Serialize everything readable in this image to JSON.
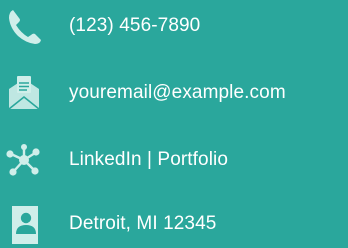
{
  "colors": {
    "background": "#2aa79c",
    "icon": "#cfeeea",
    "text": "#ffffff"
  },
  "contact": {
    "phone": {
      "icon": "phone-icon",
      "text": "(123) 456-7890"
    },
    "email": {
      "icon": "envelope-icon",
      "text": "youremail@example.com"
    },
    "links": {
      "icon": "network-icon",
      "text": "LinkedIn | Portfolio"
    },
    "location": {
      "icon": "id-card-icon",
      "text": "Detroit, MI 12345"
    }
  }
}
